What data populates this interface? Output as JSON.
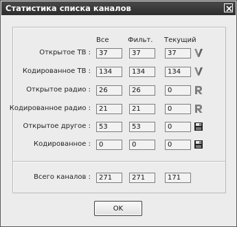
{
  "window": {
    "title": "Статистика списка каналов"
  },
  "columns": {
    "all": "Все",
    "filtered": "Фильт.",
    "current": "Текущий"
  },
  "rows": [
    {
      "label": "Открытое ТВ :",
      "all": "37",
      "filtered": "37",
      "current": "37",
      "icon": "tv-icon"
    },
    {
      "label": "Кодированное ТВ :",
      "all": "134",
      "filtered": "134",
      "current": "134",
      "icon": "tv-icon"
    },
    {
      "label": "Открытое радио :",
      "all": "26",
      "filtered": "26",
      "current": "0",
      "icon": "radio-icon"
    },
    {
      "label": "Кодированное радио :",
      "all": "21",
      "filtered": "21",
      "current": "0",
      "icon": "radio-icon"
    },
    {
      "label": "Открытое другое :",
      "all": "53",
      "filtered": "53",
      "current": "0",
      "icon": "data-icon"
    },
    {
      "label": "Кодированное :",
      "all": "0",
      "filtered": "0",
      "current": "0",
      "icon": "data-icon"
    }
  ],
  "total": {
    "label": "Всего каналов :",
    "all": "271",
    "filtered": "271",
    "current": "171"
  },
  "buttons": {
    "ok": "OK"
  }
}
